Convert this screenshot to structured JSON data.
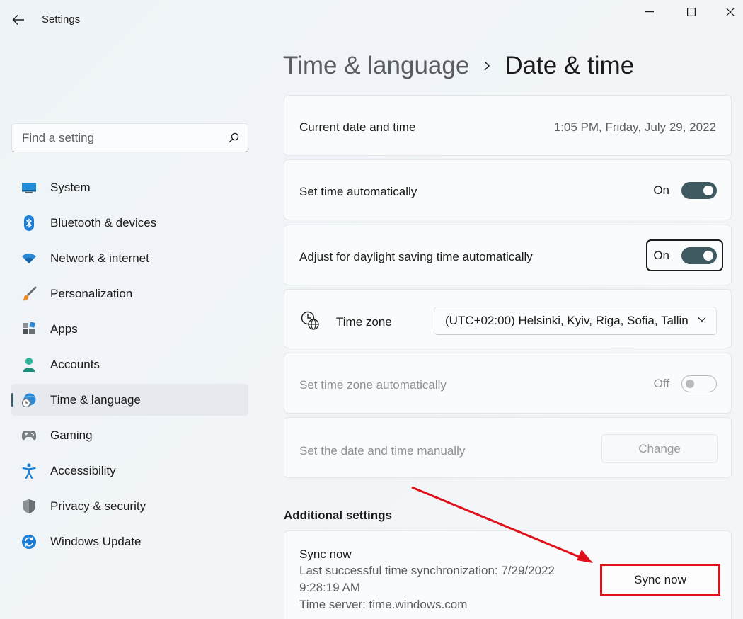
{
  "window": {
    "title": "Settings"
  },
  "search": {
    "placeholder": "Find a setting"
  },
  "sidebar": {
    "items": [
      {
        "label": "System",
        "icon": "system-icon"
      },
      {
        "label": "Bluetooth & devices",
        "icon": "bluetooth-icon"
      },
      {
        "label": "Network & internet",
        "icon": "wifi-icon"
      },
      {
        "label": "Personalization",
        "icon": "brush-icon"
      },
      {
        "label": "Apps",
        "icon": "apps-icon"
      },
      {
        "label": "Accounts",
        "icon": "person-icon"
      },
      {
        "label": "Time & language",
        "icon": "globe-clock-icon",
        "selected": true
      },
      {
        "label": "Gaming",
        "icon": "gamepad-icon"
      },
      {
        "label": "Accessibility",
        "icon": "accessibility-icon"
      },
      {
        "label": "Privacy & security",
        "icon": "shield-icon"
      },
      {
        "label": "Windows Update",
        "icon": "update-icon"
      }
    ]
  },
  "breadcrumb": {
    "parent": "Time & language",
    "separator": "›",
    "current": "Date & time"
  },
  "settings": {
    "current_datetime": {
      "label": "Current date and time",
      "value": "1:05 PM, Friday, July 29, 2022"
    },
    "set_time_auto": {
      "label": "Set time automatically",
      "state": "On",
      "on": true
    },
    "daylight_saving": {
      "label": "Adjust for daylight saving time automatically",
      "state": "On",
      "on": true,
      "focused": true
    },
    "time_zone": {
      "label": "Time zone",
      "value": "(UTC+02:00) Helsinki, Kyiv, Riga, Sofia, Tallin"
    },
    "set_tz_auto": {
      "label": "Set time zone automatically",
      "state": "Off",
      "on": false,
      "disabled": true
    },
    "manual": {
      "label": "Set the date and time manually",
      "button": "Change",
      "disabled": true
    }
  },
  "additional": {
    "title": "Additional settings",
    "sync": {
      "title": "Sync now",
      "last_sync_line1": "Last successful time synchronization: 7/29/2022",
      "last_sync_line2": "9:28:19 AM",
      "server": "Time server: time.windows.com",
      "button": "Sync now"
    }
  },
  "colors": {
    "accent": "#3f5961",
    "highlight": "#e0111b"
  }
}
